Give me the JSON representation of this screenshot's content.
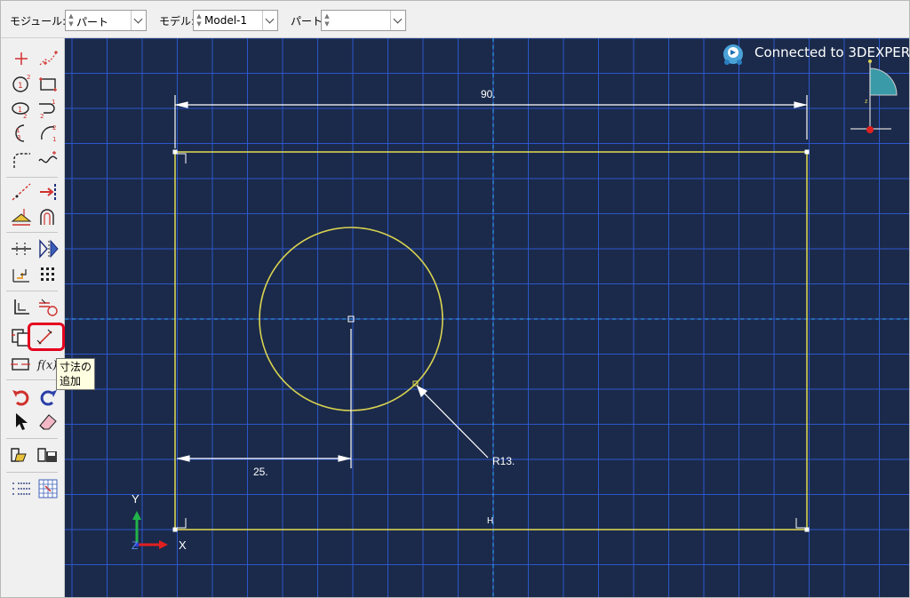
{
  "context_bar": {
    "module_label": "モジュール:",
    "module_value": "パート",
    "model_label": "モデル:",
    "model_value": "Model-1",
    "part_label": "パート:",
    "part_value": ""
  },
  "tooltip": {
    "line1": "寸法の",
    "line2": "追加"
  },
  "connection": {
    "text": "Connected to 3DEXPER"
  },
  "sketch": {
    "dim_width": "90.",
    "dim_offset": "25.",
    "dim_radius": "R13.",
    "constraint_mark": "H"
  },
  "triad": {
    "y_label": "Y",
    "x_label": "X",
    "z_label": "Z"
  },
  "toolbox_icons": [
    "point-icon",
    "spline-points-icon",
    "circle-icon",
    "rectangle-icon",
    "ellipse-icon",
    "arc-tangent-icon",
    "arc-three-point-icon",
    "arc-center-icon",
    "fillet-icon",
    "spline-icon",
    "construction-line-icon",
    "offset-edge-icon",
    "project-edges-icon",
    "sweep-icon",
    "split-icon",
    "mirror-icon",
    "linear-pattern-icon",
    "grid-pattern-icon",
    "constraint-icon",
    "auto-constraint-icon",
    "copy-icon",
    "add-dimension-icon",
    "edit-dimension-icon",
    "parameter-icon",
    "undo-icon",
    "redo-icon",
    "select-icon",
    "erase-icon",
    "open-sketch-icon",
    "save-sketch-icon",
    "sketch-options-icon",
    "sketch-grid-icon"
  ],
  "colors": {
    "viewport_bg": "#1b2a4a",
    "grid_line": "#2f5fe3",
    "sketch_geometry": "#d8d252",
    "dimension": "#ffffff",
    "highlight": "#e6001e"
  }
}
